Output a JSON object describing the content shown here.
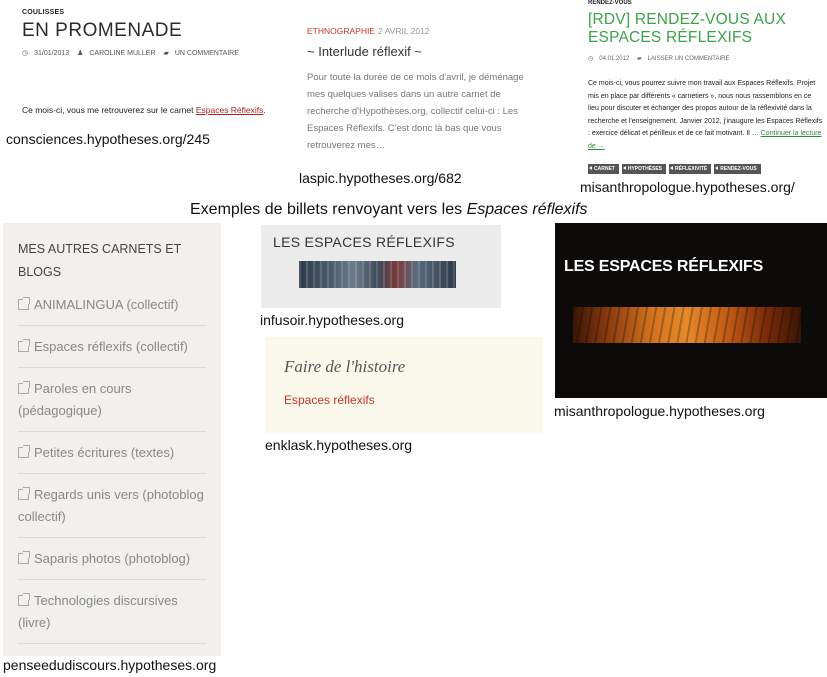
{
  "panel1": {
    "category": "COULISSES",
    "title": "EN PROMENADE",
    "date": "31/01/2013",
    "author": "CAROLINE MULLER",
    "comments": "UN COMMENTAIRE",
    "body_prefix": "Ce mois-ci, vous me retrouverez sur le carnet ",
    "body_link": "Espaces Réflexifs",
    "body_suffix": ".",
    "caption": "consciences.hypotheses.org/245"
  },
  "panel2": {
    "category": "ETHNOGRAPHIE",
    "date": "2 AVRIL 2012",
    "title": "~ Interlude réflexif ~",
    "body": "Pour toute la durée de ce mois d'avril, je déménage mes quelques valises dans un autre carnet de recherche d'Hypothèses.org, collectif celui-ci : Les Espaces Réflexifs. C'est donc là bas que vous retrouverez mes…",
    "caption": "laspic.hypotheses.org/682"
  },
  "panel3": {
    "category": "RENDEZ-VOUS",
    "title": "[RDV] RENDEZ-VOUS AUX ESPACES RÉFLEXIFS",
    "date": "04.01.2012",
    "comments": "LAISSER UN COMMENTAIRE",
    "body": "Ce mois-ci, vous pourrez suivre mon travail aux Espaces Réflexifs. Projet mis en place par différents « carnetiers », nous nous rassemblons en ce lieu pour discuter et échanger des propos autour de la réflexivité dans la recherche et l'enseignement. Janvier 2012, j'inaugure les Espaces Réflexifs : exercice délicat et périlleux et de ce fait motivant. Il … ",
    "read_more": "Continuer la lecture de →",
    "tags": [
      "CARNET",
      "HYPOTHÈSES",
      "RÉFLEXIVITÉ",
      "RENDEZ-VOUS"
    ],
    "caption": "misanthropologue.hypotheses.org/"
  },
  "heading": {
    "prefix": "Exemples de billets renvoyant vers les ",
    "emphasis": "Espaces réflexifs"
  },
  "sidebar": {
    "title": "MES AUTRES CARNETS ET BLOGS",
    "items": [
      "ANIMALINGUA (collectif)",
      "Espaces réflexifs (collectif)",
      "Paroles en cours (pédagogique)",
      "Petites écritures (textes)",
      "Regards unis vers (photoblog collectif)",
      "Saparis photos (photoblog)",
      "Technologies discursives (livre)"
    ],
    "caption": "penseedudiscours.hypotheses.org"
  },
  "infusoir": {
    "title": "LES ESPACES RÉFLEXIFS",
    "caption": "infusoir.hypotheses.org"
  },
  "enklask": {
    "title": "Faire de l'histoire",
    "link": "Espaces réflexifs",
    "caption": "enklask.hypotheses.org"
  },
  "misanthropologue_widget": {
    "title": "LES ESPACES RÉFLEXIFS",
    "caption": "misanthropologue.hypotheses.org"
  },
  "colors": {
    "link_red": "#c0392b",
    "title_green": "#3aa24a",
    "sidebar_bg": "#f1f0ec",
    "enklask_bg": "#faf8ea",
    "dark_bg": "#0c0b0a"
  }
}
